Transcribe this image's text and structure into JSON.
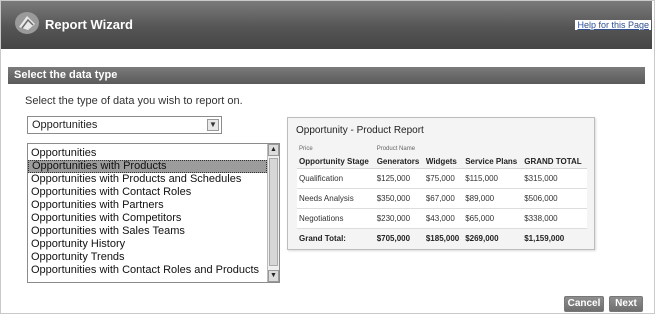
{
  "header": {
    "title": "Report Wizard",
    "help_link": "Help for this Page"
  },
  "section": {
    "title": "Select the data type",
    "instruction": "Select the type of data you wish to report on."
  },
  "data_type_select": {
    "selected": "Opportunities"
  },
  "data_type_list": {
    "items": [
      "Opportunities",
      "Opportunities with Products",
      "Opportunities with Products and Schedules",
      "Opportunities with Contact Roles",
      "Opportunities with Partners",
      "Opportunities with Competitors",
      "Opportunities with Sales Teams",
      "Opportunity History",
      "Opportunity Trends",
      "Opportunities with Contact Roles and Products"
    ],
    "selected_index": 1
  },
  "preview": {
    "title": "Opportunity - Product Report",
    "group_labels": [
      "Price",
      "Product Name"
    ],
    "columns": [
      "Opportunity Stage",
      "Generators",
      "Widgets",
      "Service Plans",
      "GRAND TOTAL"
    ],
    "rows": [
      [
        "Qualification",
        "$125,000",
        "$75,000",
        "$115,000",
        "$315,000"
      ],
      [
        "Needs Analysis",
        "$350,000",
        "$67,000",
        "$89,000",
        "$506,000"
      ],
      [
        "Negotiations",
        "$230,000",
        "$43,000",
        "$65,000",
        "$338,000"
      ]
    ],
    "total": [
      "Grand Total:",
      "$705,000",
      "$185,000",
      "$269,000",
      "$1,159,000"
    ]
  },
  "buttons": {
    "cancel": "Cancel",
    "next": "Next"
  },
  "colors": {
    "header_bg": "#555555",
    "section_bar_bg": "#6a6a6a",
    "link": "#2f4f8f"
  }
}
